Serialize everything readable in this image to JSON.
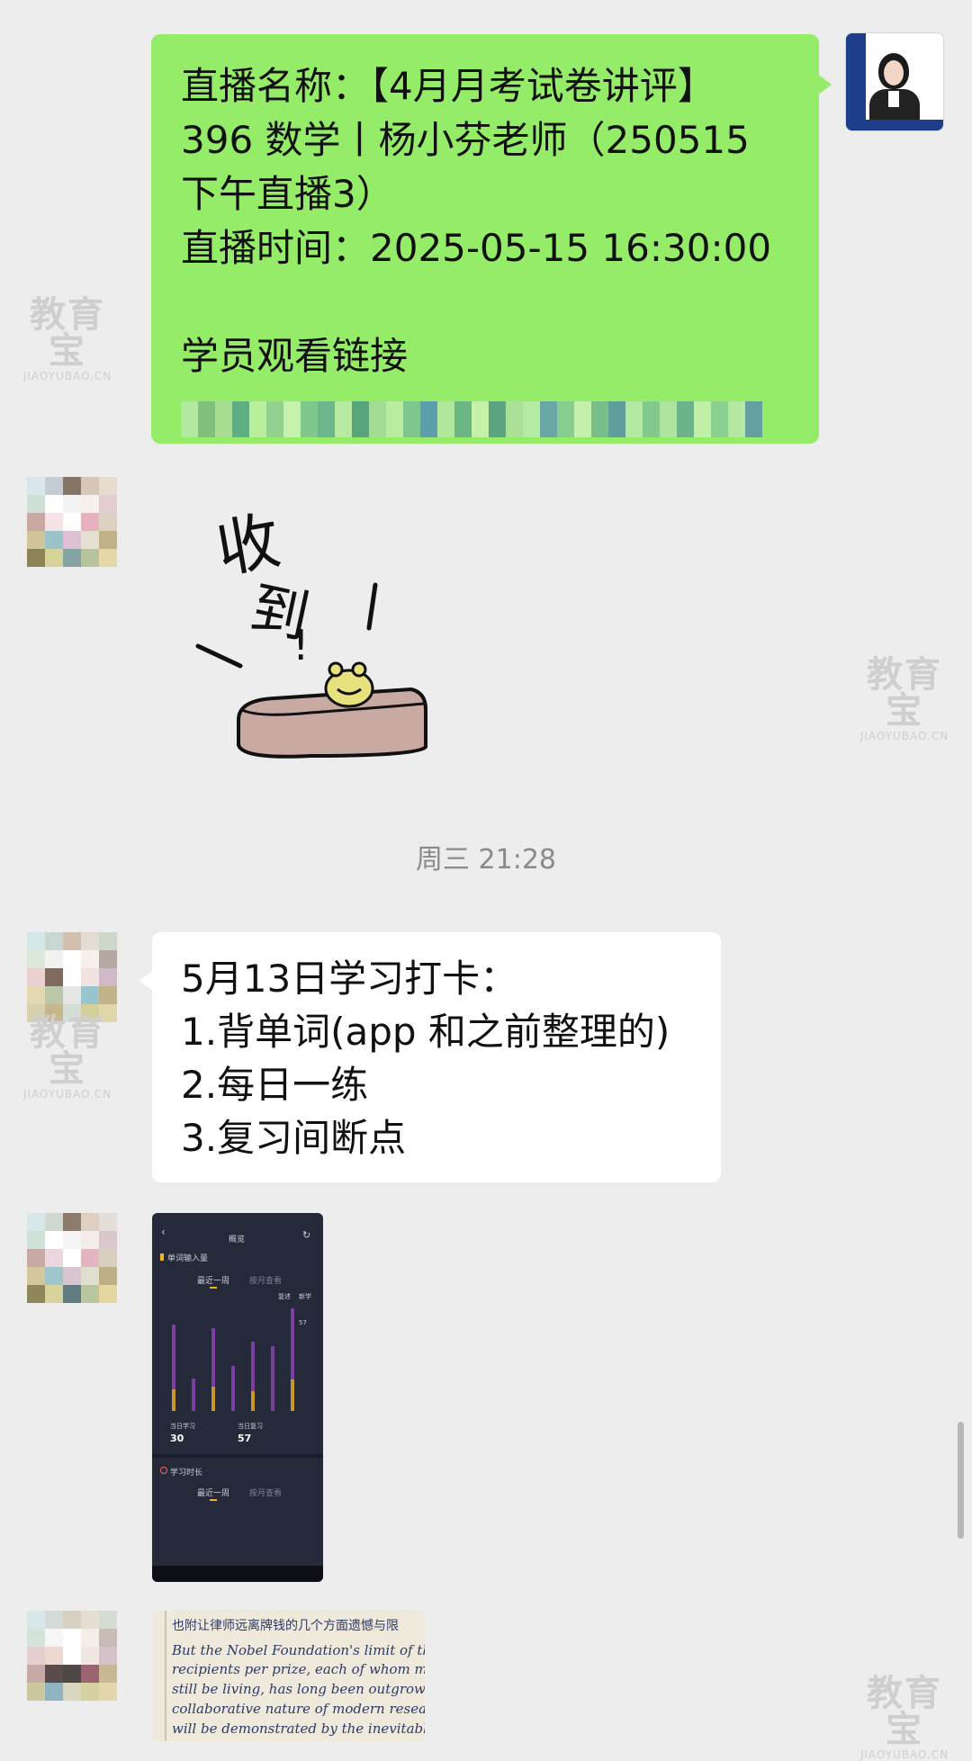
{
  "messages": {
    "live_notice": {
      "lines": [
        "直播名称：【4月月考试卷讲评】",
        "396 数学丨杨小芬老师（250515",
        "下午直播3）",
        "直播时间：2025-05-15 16:30:00",
        "",
        "学员观看链接"
      ]
    },
    "sticker": {
      "text_top": "收",
      "text_bottom": "到",
      "exclaim": "!"
    },
    "timestamp": "周三 21:28",
    "checkin": {
      "lines": [
        "5月13日学习打卡：",
        "1.背单词(app 和之前整理的)",
        "2.每日一练",
        "3.复习间断点"
      ]
    },
    "app_screenshot": {
      "title": "概览",
      "section1": "单词输入量",
      "tab_week": "最近一周",
      "tab_month": "按月查看",
      "legend_a": "复述",
      "legend_b": "新学",
      "bar_top_label": "57",
      "stat1_label": "当日学习",
      "stat1_value": "30",
      "stat2_label": "当日复习",
      "stat2_value": "57",
      "section2": "学习时长",
      "tab_week2": "最近一周",
      "tab_month2": "按月查看",
      "bars": [
        {
          "purple": 0.5,
          "yellow": 0.22
        },
        {
          "purple": 0.25,
          "yellow": 0.0
        },
        {
          "purple": 0.45,
          "yellow": 0.25
        },
        {
          "purple": 0.35,
          "yellow": 0.0
        },
        {
          "purple": 0.38,
          "yellow": 0.2
        },
        {
          "purple": 0.5,
          "yellow": 0.0
        },
        {
          "purple": 0.55,
          "yellow": 0.32
        }
      ]
    },
    "notebook": {
      "lines": [
        "也附让律师远离牌钱的几个方面遗憾与限",
        "But the Nobel Foundation's limit of three",
        "recipients per prize, each of whom must",
        "still be living, has long been outgrown by the",
        "collaborative nature of modern research-as",
        "will be demonstrated by the inevitable row"
      ]
    }
  },
  "watermark": {
    "brand": "教育宝",
    "domain": "JIAOYUBAO.CN"
  },
  "colors": {
    "background": "#ededed",
    "sent_bubble": "#95ec69",
    "received_bubble": "#ffffff",
    "timestamp": "#8a8a8a"
  }
}
